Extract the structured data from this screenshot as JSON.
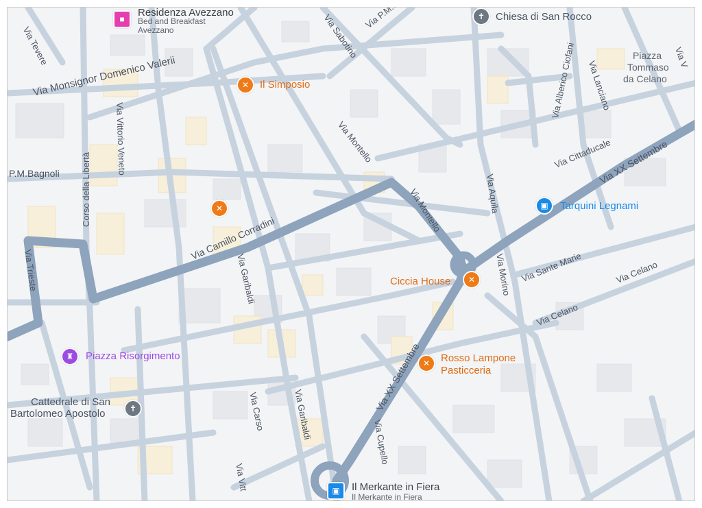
{
  "map": {
    "colors": {
      "background": "#f3f4f6",
      "block": "#e6e8ec",
      "block_warm": "#f7efd9",
      "street": "#c7d2df",
      "main_street": "#8ea3bc",
      "street_label": "#4a5361",
      "restaurant": "#ee7b18",
      "church": "#6d7883",
      "shop": "#1a8ae8",
      "hotel": "#e43fb0",
      "monument": "#9c4be2"
    },
    "streets": {
      "tevere": "Via Tevere",
      "sabotino": "Via Sabotino",
      "via_p_m": "Via P.M...",
      "valeri": "Via Monsignor Domenico Valerii",
      "bagnoli": "P.M.Bagnoli",
      "liberta": "Corso della Libertà",
      "vittorio_veneto": "Via Vittorio Veneto",
      "corradini": "Via Camillo Corradini",
      "garibaldi_1": "Via Garibaldi",
      "garibaldi_2": "Via Garibaldi",
      "trieste": "Via Trieste",
      "montello_1": "Via Montello",
      "montello_2": "Via Montello",
      "aquila": "Via Aquila",
      "ciofani": "Via Alberico Ciofani",
      "lanciano": "Via Lanciano",
      "cittaducale": "Via Cittaducale",
      "xx_settembre_1": "Via XX Settembre",
      "xx_settembre_2": "Via XX Settembre",
      "sante_marie": "Via Sante Marie",
      "celano_1": "Via Celano",
      "celano_2": "Via Celano",
      "morino": "Via Morino",
      "carso": "Via Carso",
      "cupello": "Via Cupello",
      "vitt_partial": "Via Vitt",
      "via_v_partial": "Via V"
    },
    "pois": {
      "residenza": {
        "name": "Residenza Avezzano",
        "sub1": "Bed and Breakfast",
        "sub2": "Avezzano",
        "icon": "hotel-icon"
      },
      "chiesa_rocco": {
        "name": "Chiesa di San Rocco",
        "icon": "church-cross-icon"
      },
      "simposio": {
        "name": "Il Simposio",
        "icon": "restaurant-icon"
      },
      "piazza_tommaso": {
        "line1": "Piazza",
        "line2": "Tommaso",
        "line3": "da Celano"
      },
      "tarquini": {
        "name": "Tarquini Legnami",
        "icon": "shopping-bag-icon"
      },
      "ciccia": {
        "name": "Ciccia House",
        "icon": "restaurant-icon"
      },
      "rosso": {
        "line1": "Rosso Lampone",
        "line2": "Pasticceria",
        "icon": "restaurant-icon"
      },
      "risorgimento": {
        "name": "Piazza Risorgimento",
        "icon": "castle-icon"
      },
      "cattedrale": {
        "line1": "Cattedrale di San",
        "line2": "Bartolomeo Apostolo",
        "icon": "church-cross-icon"
      },
      "merkante": {
        "name": "Il Merkante in Fiera",
        "sub": "Il Merkante in Fiera",
        "icon": "shopping-bag-icon"
      },
      "unnamed_restaurant": {
        "icon": "restaurant-icon"
      }
    }
  }
}
